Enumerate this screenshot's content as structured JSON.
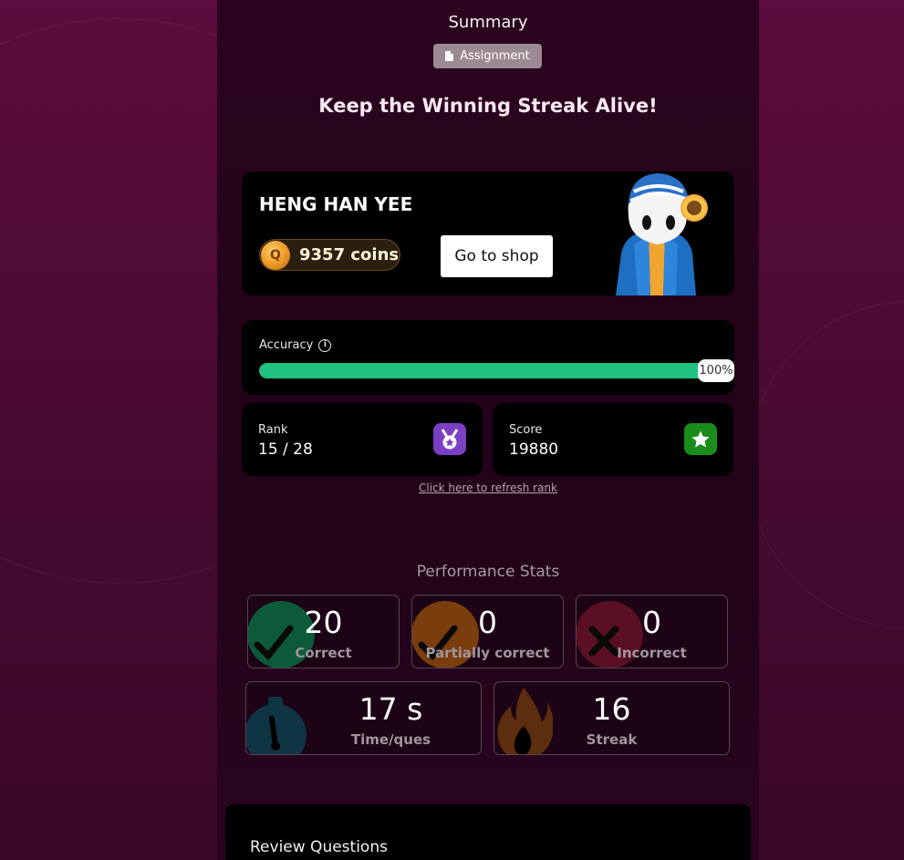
{
  "header": {
    "title": "Summary",
    "chip_label": "Assignment",
    "headline": "Keep the Winning Streak Alive!"
  },
  "profile": {
    "player_name": "HENG HAN YEE",
    "coins_text": "9357 coins",
    "coin_symbol": "Q",
    "shop_button_label": "Go to shop"
  },
  "accuracy": {
    "label": "Accuracy",
    "info_symbol": "i",
    "percent_value": 100,
    "percent_label": "100%",
    "bar_color": "#1ec17f"
  },
  "rank": {
    "label": "Rank",
    "value": "15 / 28",
    "icon": "medal-icon",
    "icon_color": "#7b3fc4"
  },
  "score": {
    "label": "Score",
    "value": "19880",
    "icon": "star-icon",
    "icon_color": "#1a8c1a"
  },
  "refresh_link_label": "Click here to refresh rank",
  "performance": {
    "title": "Performance Stats",
    "stats": [
      {
        "value": "20",
        "label": "Correct",
        "icon": "check-icon",
        "color": "#0d5a3a"
      },
      {
        "value": "0",
        "label": "Partially correct",
        "icon": "check-icon",
        "color": "#7a3d0e"
      },
      {
        "value": "0",
        "label": "Incorrect",
        "icon": "cross-icon",
        "color": "#5a0f22"
      },
      {
        "value": "17 s",
        "label": "Time/ques",
        "icon": "stopwatch-icon",
        "color": "#0f3545"
      },
      {
        "value": "16",
        "label": "Streak",
        "icon": "flame-icon",
        "color": "#5c2e0f"
      }
    ]
  },
  "review": {
    "title": "Review Questions"
  }
}
